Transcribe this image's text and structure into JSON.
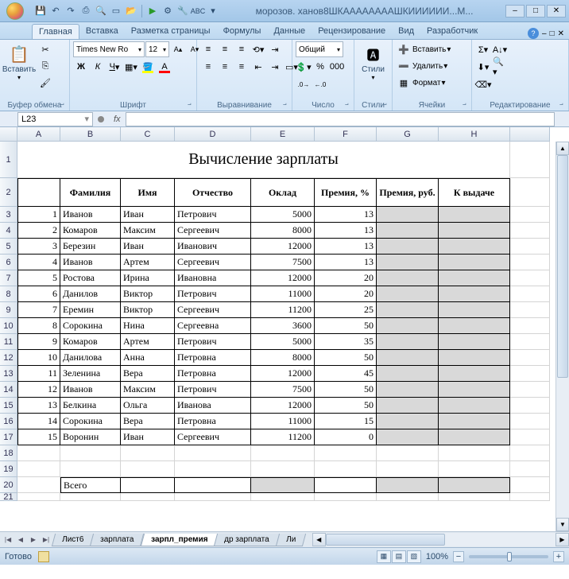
{
  "title": "морозов. ханов8ШКААААААААШКИИИИИИ...М...",
  "tabs": [
    "Главная",
    "Вставка",
    "Разметка страницы",
    "Формулы",
    "Данные",
    "Рецензирование",
    "Вид",
    "Разработчик"
  ],
  "active_tab": 0,
  "ribbon": {
    "paste": "Вставить",
    "clipboard_group": "Буфер обмена",
    "font_name": "Times New Ro",
    "font_size": "12",
    "font_group": "Шрифт",
    "align_group": "Выравнивание",
    "number_format": "Общий",
    "number_group": "Число",
    "styles": "Стили",
    "styles_group": "Стили",
    "insert": "Вставить",
    "delete": "Удалить",
    "format": "Формат",
    "cells_group": "Ячейки",
    "editing_group": "Редактирование"
  },
  "namebox": "L23",
  "columns": [
    "A",
    "B",
    "C",
    "D",
    "E",
    "F",
    "G",
    "H"
  ],
  "table_title": "Вычисление зарплаты",
  "headers": {
    "fam": "Фамилия",
    "name": "Имя",
    "pat": "Отчество",
    "oklad": "Оклад",
    "prem_pct": "Премия, %",
    "prem_rub": "Премия, руб.",
    "total": "К выдаче"
  },
  "rows": [
    {
      "n": "1",
      "f": "Иванов",
      "i": "Иван",
      "o": "Петрович",
      "ok": "5000",
      "p": "13"
    },
    {
      "n": "2",
      "f": "Комаров",
      "i": "Максим",
      "o": "Сергеевич",
      "ok": "8000",
      "p": "13"
    },
    {
      "n": "3",
      "f": "Березин",
      "i": "Иван",
      "o": "Иванович",
      "ok": "12000",
      "p": "13"
    },
    {
      "n": "4",
      "f": "Иванов",
      "i": "Артем",
      "o": "Сергеевич",
      "ok": "7500",
      "p": "13"
    },
    {
      "n": "5",
      "f": "Ростова",
      "i": "Ирина",
      "o": "Ивановна",
      "ok": "12000",
      "p": "20"
    },
    {
      "n": "6",
      "f": "Данилов",
      "i": "Виктор",
      "o": "Петрович",
      "ok": "11000",
      "p": "20"
    },
    {
      "n": "7",
      "f": "Еремин",
      "i": "Виктор",
      "o": "Сергеевич",
      "ok": "11200",
      "p": "25"
    },
    {
      "n": "8",
      "f": "Сорокина",
      "i": "Нина",
      "o": "Сергеевна",
      "ok": "3600",
      "p": "50"
    },
    {
      "n": "9",
      "f": "Комаров",
      "i": "Артем",
      "o": "Петрович",
      "ok": "5000",
      "p": "35"
    },
    {
      "n": "10",
      "f": "Данилова",
      "i": "Анна",
      "o": "Петровна",
      "ok": "8000",
      "p": "50"
    },
    {
      "n": "11",
      "f": "Зеленина",
      "i": "Вера",
      "o": "Петровна",
      "ok": "12000",
      "p": "45"
    },
    {
      "n": "12",
      "f": "Иванов",
      "i": "Максим",
      "o": "Петрович",
      "ok": "7500",
      "p": "50"
    },
    {
      "n": "13",
      "f": "Белкина",
      "i": "Ольга",
      "o": "Иванова",
      "ok": "12000",
      "p": "50"
    },
    {
      "n": "14",
      "f": "Сорокина",
      "i": "Вера",
      "o": "Петровна",
      "ok": "11000",
      "p": "15"
    },
    {
      "n": "15",
      "f": "Воронин",
      "i": "Иван",
      "o": "Сергеевич",
      "ok": "11200",
      "p": "0"
    }
  ],
  "total_label": "Всего",
  "sheet_tabs": [
    "Лист6",
    "зарплата",
    "зарпл_премия",
    "др зарплата",
    "Ли"
  ],
  "active_sheet": 2,
  "status": {
    "ready": "Готово",
    "zoom": "100%"
  }
}
